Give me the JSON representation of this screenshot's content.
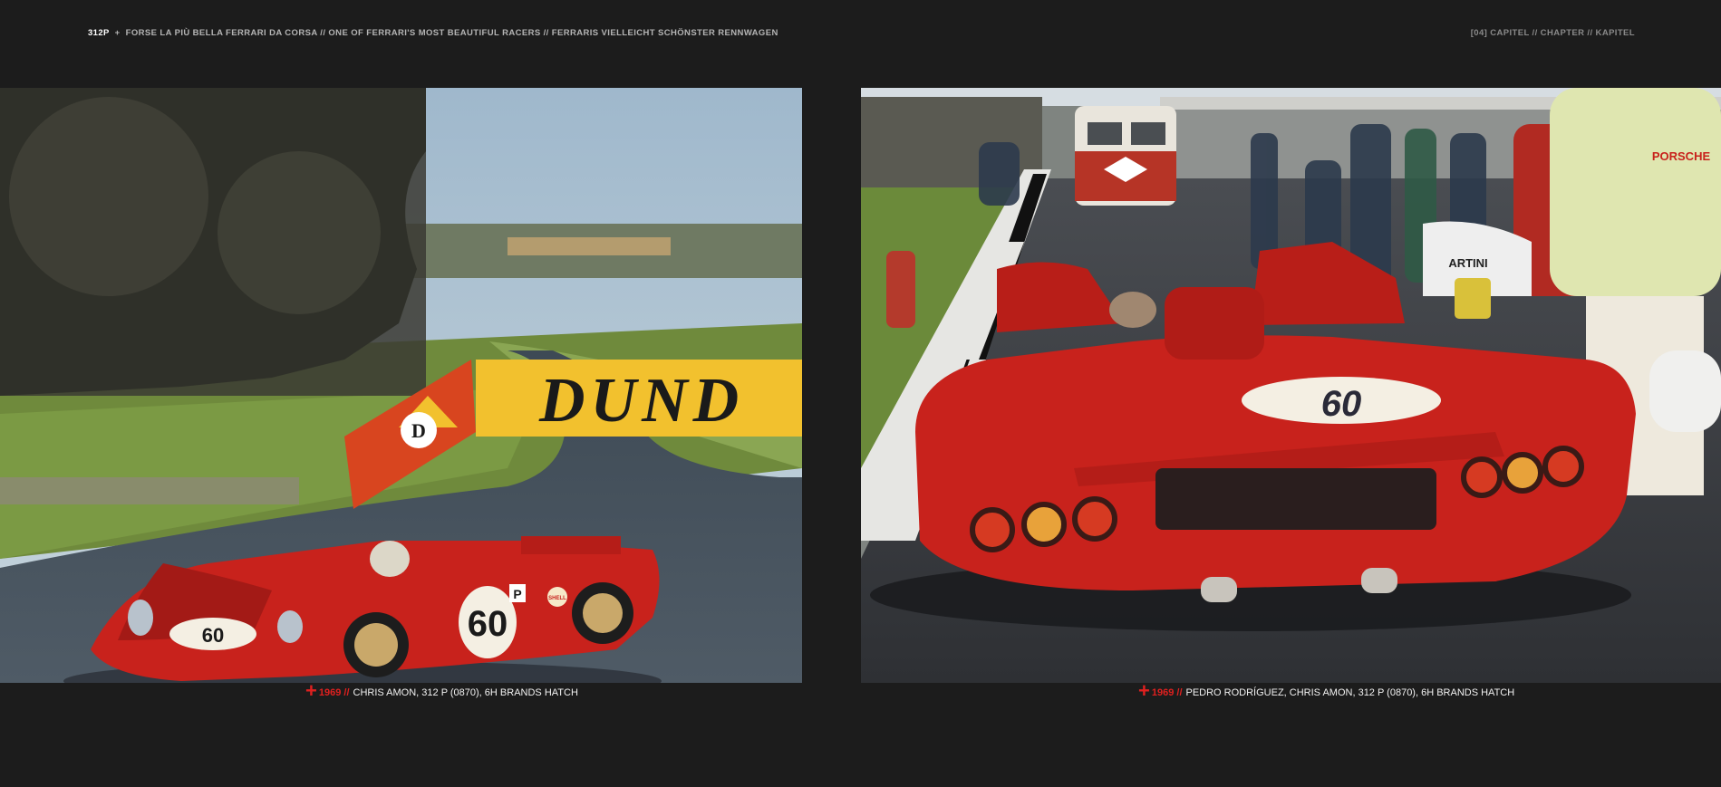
{
  "header": {
    "title": "312P",
    "sep": "+",
    "subtitle": "FORSE LA PIÙ BELLA FERRARI DA CORSA // ONE OF FERRARI'S MOST BEAUTIFUL RACERS // FERRARIS VIELLEICHT SCHÖNSTER RENNWAGEN",
    "chapter": "[04]  CAPITEL // CHAPTER // KAPITEL"
  },
  "photo_left": {
    "banner_text": "DUND",
    "logo_letter": "D",
    "car_number_front": "60",
    "car_number_side": "60",
    "badge": "P",
    "sponsor": "SHELL"
  },
  "photo_right": {
    "car_number": "60",
    "jacket_text": "PORSCHE",
    "car_text": "ARTINI"
  },
  "captions": [
    {
      "cross": "+",
      "year": "1969 //",
      "text": "CHRIS AMON, 312 P (0870), 6H BRANDS HATCH"
    },
    {
      "cross": "+",
      "year": "1969 //",
      "text": "PEDRO RODRÍGUEZ, CHRIS AMON, 312 P (0870), 6H BRANDS HATCH"
    }
  ],
  "colors": {
    "background": "#1c1c1c",
    "accent_red": "#e0201f",
    "ferrari_red": "#c8221c",
    "dunlop_yellow": "#f2c12e"
  }
}
